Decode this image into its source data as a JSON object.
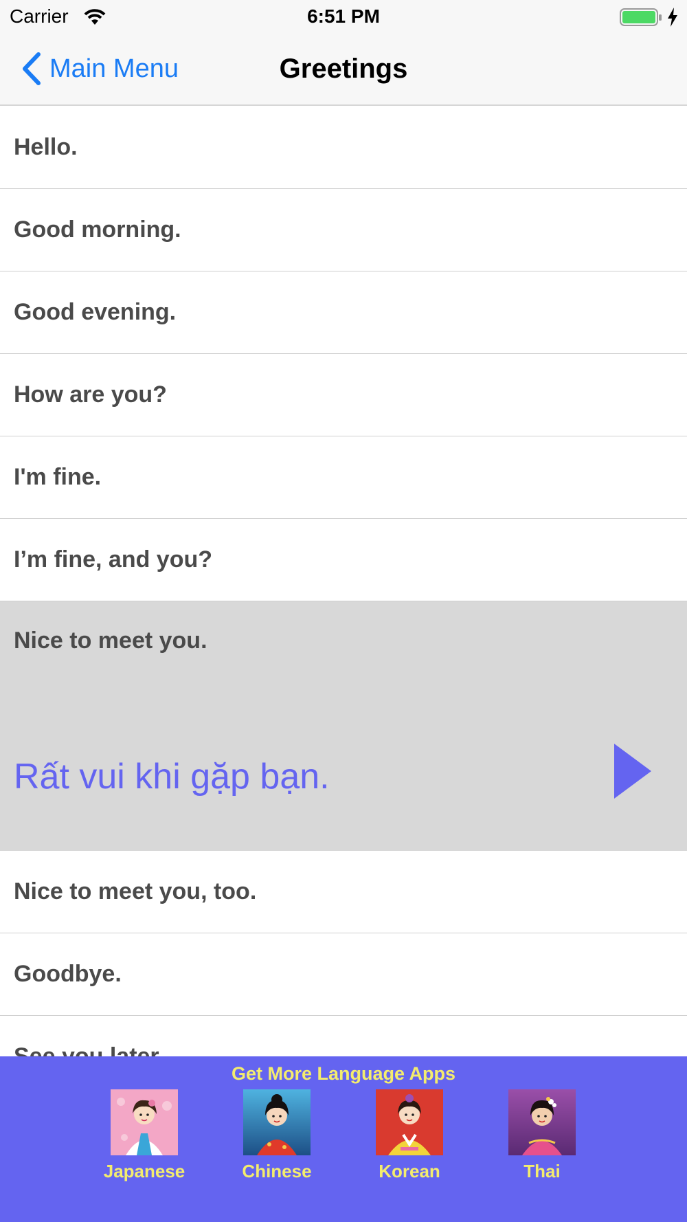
{
  "status_bar": {
    "carrier": "Carrier",
    "time": "6:51 PM",
    "battery_color": "#4cd964"
  },
  "nav": {
    "back_label": "Main Menu",
    "title": "Greetings",
    "accent_color": "#1a7cf5"
  },
  "phrases": [
    {
      "label": "Hello."
    },
    {
      "label": "Good morning."
    },
    {
      "label": "Good evening."
    },
    {
      "label": "How are you?"
    },
    {
      "label": "I'm fine."
    },
    {
      "label": "I’m fine, and you?"
    },
    {
      "label": "Nice to meet you.",
      "translation": "Rất vui khi gặp bạn.",
      "expanded": true
    },
    {
      "label": "Nice to meet you, too."
    },
    {
      "label": "Goodbye."
    },
    {
      "label": "See you later."
    }
  ],
  "promo": {
    "title": "Get More Language Apps",
    "background_color": "#6464f0",
    "text_color": "#f3ec6e",
    "apps": [
      {
        "label": "Japanese",
        "icon": "japanese-girl-avatar"
      },
      {
        "label": "Chinese",
        "icon": "chinese-girl-avatar"
      },
      {
        "label": "Korean",
        "icon": "korean-girl-avatar"
      },
      {
        "label": "Thai",
        "icon": "thai-girl-avatar"
      }
    ]
  }
}
